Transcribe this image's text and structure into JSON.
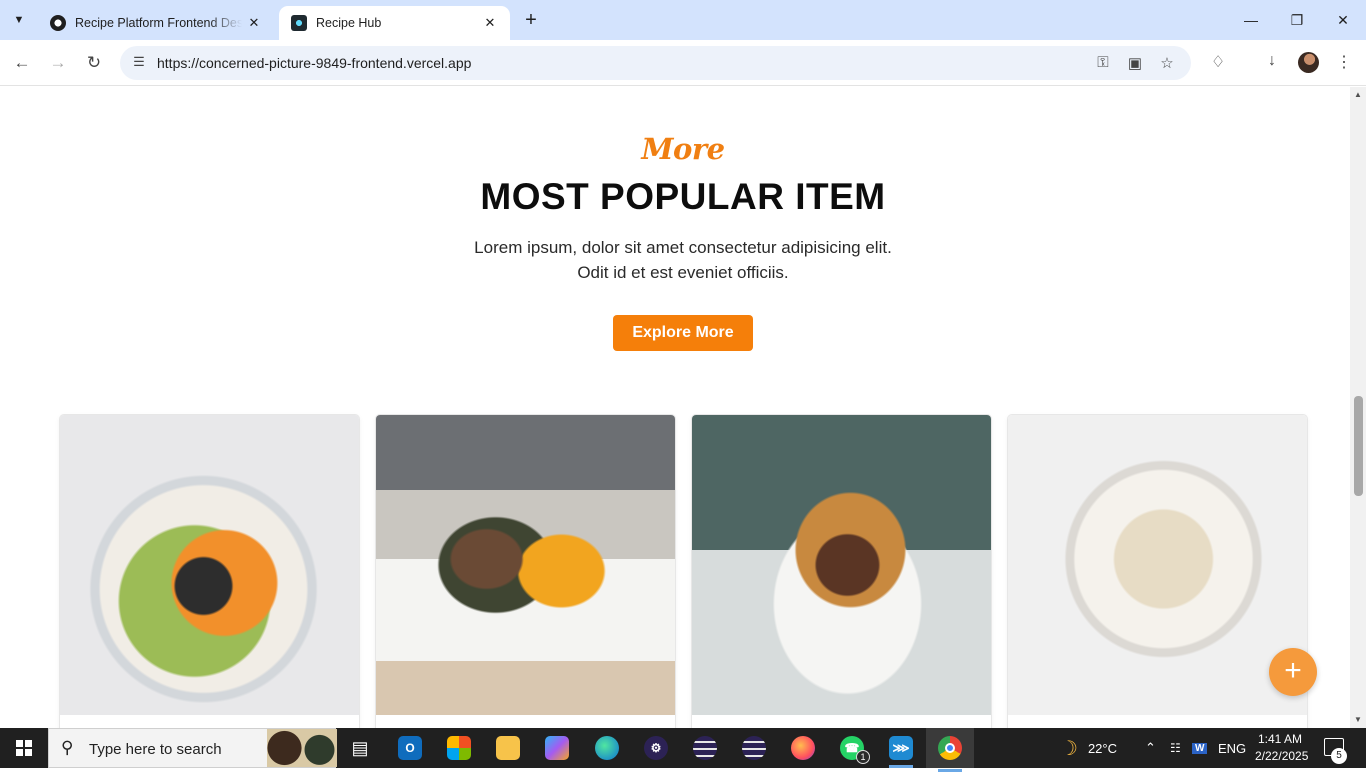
{
  "browser": {
    "tabs": [
      {
        "title": "Recipe Platform Frontend Design",
        "favicon": "openai-icon",
        "active": false
      },
      {
        "title": "Recipe Hub",
        "favicon": "react-icon",
        "active": true
      }
    ],
    "url": "https://concerned-picture-9849-frontend.vercel.app"
  },
  "section": {
    "kicker": "More",
    "heading": "MOST POPULAR ITEM",
    "description_line1": "Lorem ipsum, dolor sit amet consectetur adipisicing elit.",
    "description_line2": "Odit id et est eveniet officiis.",
    "button_label": "Explore More",
    "accent_color": "#f57f0a"
  },
  "cards": [
    {
      "image": "buddha-bowl-photo"
    },
    {
      "image": "stuffed-squash-photo"
    },
    {
      "image": "burger-photo"
    },
    {
      "image": "roasted-cauliflower-photo"
    }
  ],
  "fab": {
    "label": "+"
  },
  "taskbar": {
    "search_placeholder": "Type here to search",
    "weather": "22°C",
    "language": "ENG",
    "time": "1:41 AM",
    "date": "2/22/2025",
    "whatsapp_badge": "1",
    "notification_count": "5"
  }
}
